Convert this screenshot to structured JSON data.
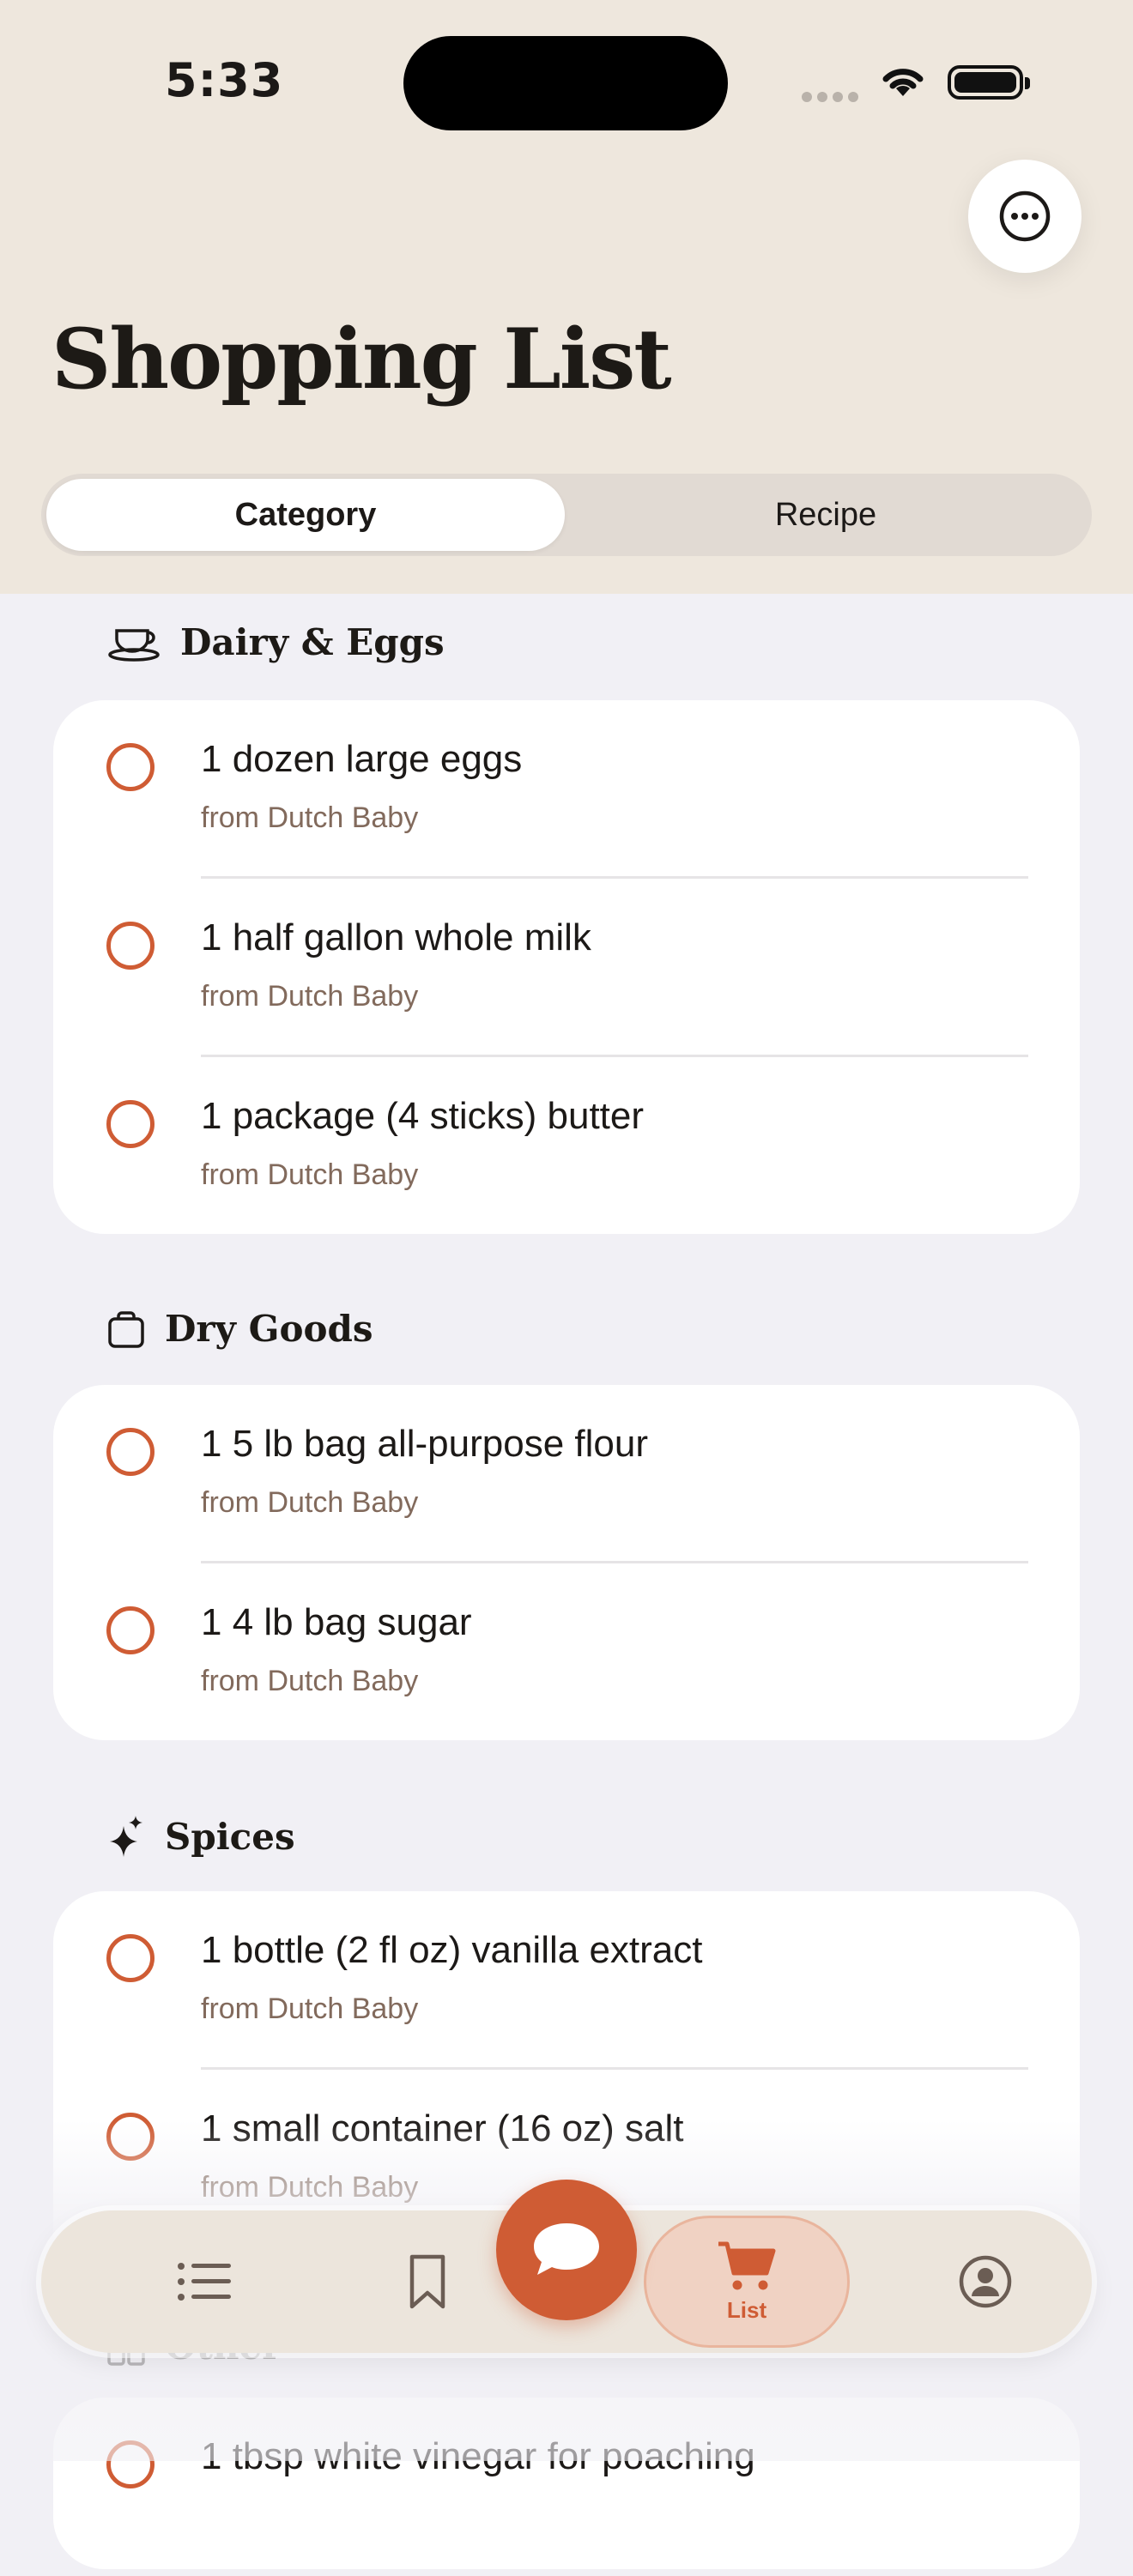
{
  "status_bar": {
    "time": "5:33"
  },
  "header": {
    "title": "Shopping List"
  },
  "segments": {
    "category": "Category",
    "recipe": "Recipe"
  },
  "sections": [
    {
      "title": "Dairy & Eggs",
      "icon": "teacup-icon",
      "items": [
        {
          "name": "1 dozen large eggs",
          "source": "from Dutch Baby"
        },
        {
          "name": "1 half gallon whole milk",
          "source": "from Dutch Baby"
        },
        {
          "name": "1 package (4 sticks) butter",
          "source": "from Dutch Baby"
        }
      ]
    },
    {
      "title": "Dry Goods",
      "icon": "bag-icon",
      "items": [
        {
          "name": "1 5 lb bag all-purpose flour",
          "source": "from Dutch Baby"
        },
        {
          "name": "1 4 lb bag sugar",
          "source": "from Dutch Baby"
        }
      ]
    },
    {
      "title": "Spices",
      "icon": "sparkle-icon",
      "items": [
        {
          "name": "1 bottle (2 fl oz) vanilla extract",
          "source": "from Dutch Baby"
        },
        {
          "name": "1 small container (16 oz) salt",
          "source": "from Dutch Baby"
        }
      ]
    },
    {
      "title": "Other",
      "icon": "grid-icon",
      "items": [
        {
          "name": "1 tbsp white vinegar for poaching",
          "source": ""
        }
      ]
    }
  ],
  "tab_bar": {
    "cart_label": "List"
  },
  "colors": {
    "accent": "#cf5c34",
    "header_bg": "#eee7dd",
    "page_bg": "#f1f0f5"
  }
}
